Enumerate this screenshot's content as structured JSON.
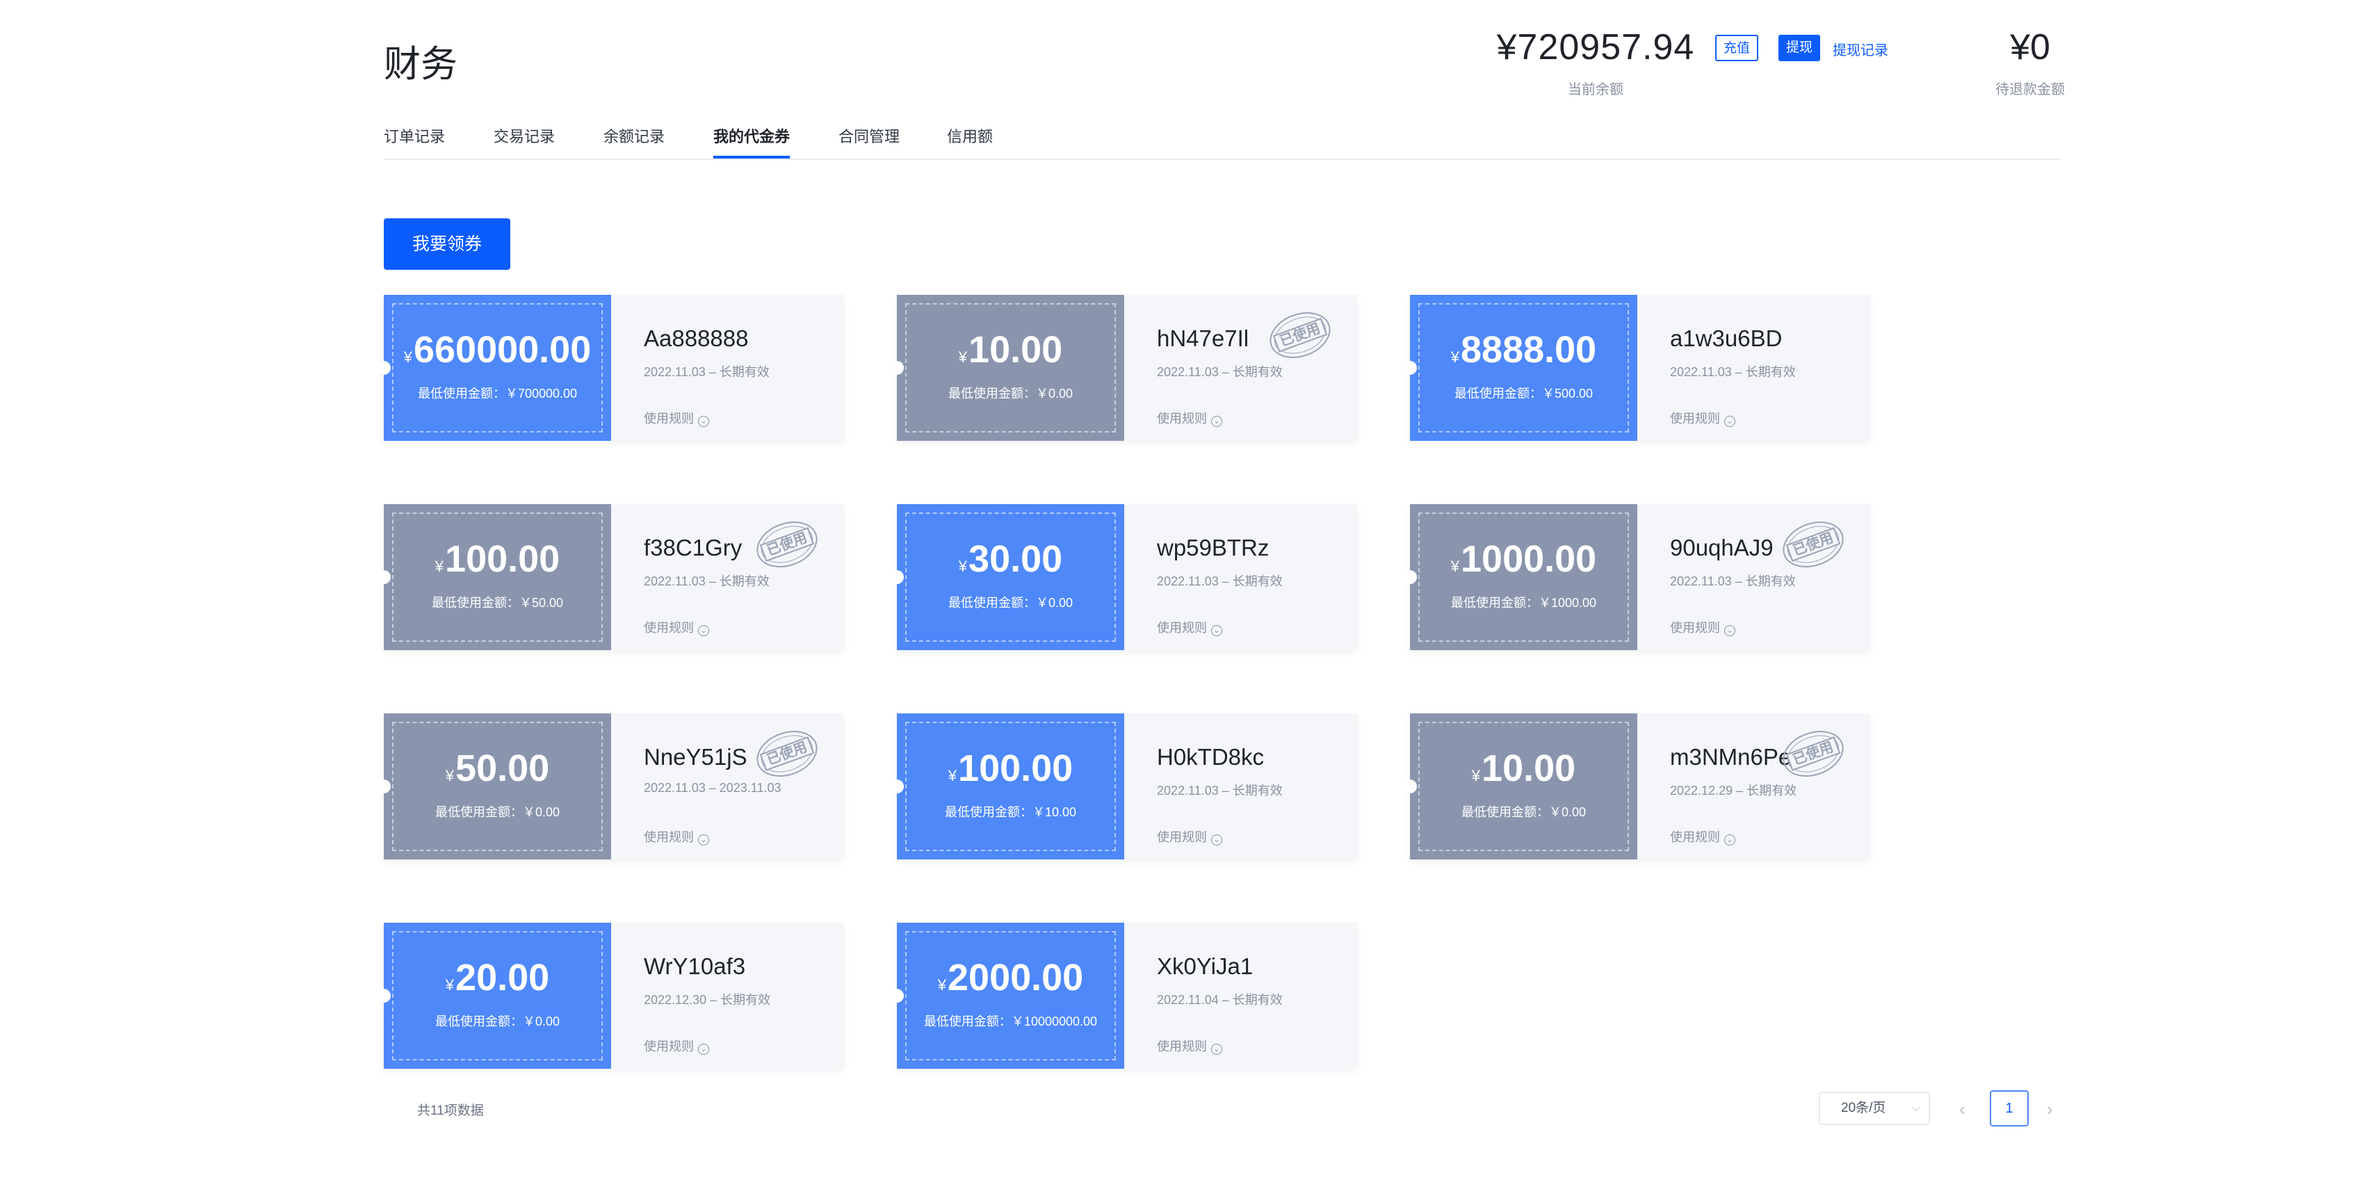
{
  "header": {
    "title": "财务",
    "balance": "¥720957.94",
    "balance_label": "当前余额",
    "recharge_label": "充值",
    "withdraw_label": "提现",
    "withdraw_record_label": "提现记录",
    "refund_amount": "¥0",
    "refund_label": "待退款金额"
  },
  "tabs": [
    {
      "label": "订单记录",
      "active": false
    },
    {
      "label": "交易记录",
      "active": false
    },
    {
      "label": "余额记录",
      "active": false
    },
    {
      "label": "我的代金券",
      "active": true
    },
    {
      "label": "合同管理",
      "active": false
    },
    {
      "label": "信用额",
      "active": false
    }
  ],
  "claim_button": "我要领券",
  "coupons": [
    {
      "amount": "660000.00",
      "min_use": "最低使用金额：￥700000.00",
      "code": "Aa888888",
      "validity": "2022.11.03 – 长期有效",
      "rule": "使用规则",
      "used": false
    },
    {
      "amount": "10.00",
      "min_use": "最低使用金额：￥0.00",
      "code": "hN47e7Il",
      "validity": "2022.11.03 – 长期有效",
      "rule": "使用规则",
      "used": true
    },
    {
      "amount": "8888.00",
      "min_use": "最低使用金额：￥500.00",
      "code": "a1w3u6BD",
      "validity": "2022.11.03 – 长期有效",
      "rule": "使用规则",
      "used": false
    },
    {
      "amount": "100.00",
      "min_use": "最低使用金额：￥50.00",
      "code": "f38C1Gry",
      "validity": "2022.11.03 – 长期有效",
      "rule": "使用规则",
      "used": true
    },
    {
      "amount": "30.00",
      "min_use": "最低使用金额：￥0.00",
      "code": "wp59BTRz",
      "validity": "2022.11.03 – 长期有效",
      "rule": "使用规则",
      "used": false
    },
    {
      "amount": "1000.00",
      "min_use": "最低使用金额：￥1000.00",
      "code": "90uqhAJ9",
      "validity": "2022.11.03 – 长期有效",
      "rule": "使用规则",
      "used": true
    },
    {
      "amount": "50.00",
      "min_use": "最低使用金额：￥0.00",
      "code": "NneY51jS",
      "validity": "2022.11.03 – 2023.11.03",
      "rule": "使用规则",
      "used": true
    },
    {
      "amount": "100.00",
      "min_use": "最低使用金额：￥10.00",
      "code": "H0kTD8kc",
      "validity": "2022.11.03 – 长期有效",
      "rule": "使用规则",
      "used": false
    },
    {
      "amount": "10.00",
      "min_use": "最低使用金额：￥0.00",
      "code": "m3NMn6Pe",
      "validity": "2022.12.29 – 长期有效",
      "rule": "使用规则",
      "used": true
    },
    {
      "amount": "20.00",
      "min_use": "最低使用金额：￥0.00",
      "code": "WrY10af3",
      "validity": "2022.12.30 – 长期有效",
      "rule": "使用规则",
      "used": false
    },
    {
      "amount": "2000.00",
      "min_use": "最低使用金额：￥10000000.00",
      "code": "Xk0YiJa1",
      "validity": "2022.11.04 – 长期有效",
      "rule": "使用规则",
      "used": false
    }
  ],
  "currency_symbol": "¥",
  "used_stamp_text": "已使用",
  "footer": {
    "total": "共11项数据",
    "page_size": "20条/页",
    "current_page": "1"
  },
  "colors": {
    "accent": "#0b5cff",
    "coupon_active": "#4e88f9",
    "coupon_used": "#8a95ad"
  }
}
